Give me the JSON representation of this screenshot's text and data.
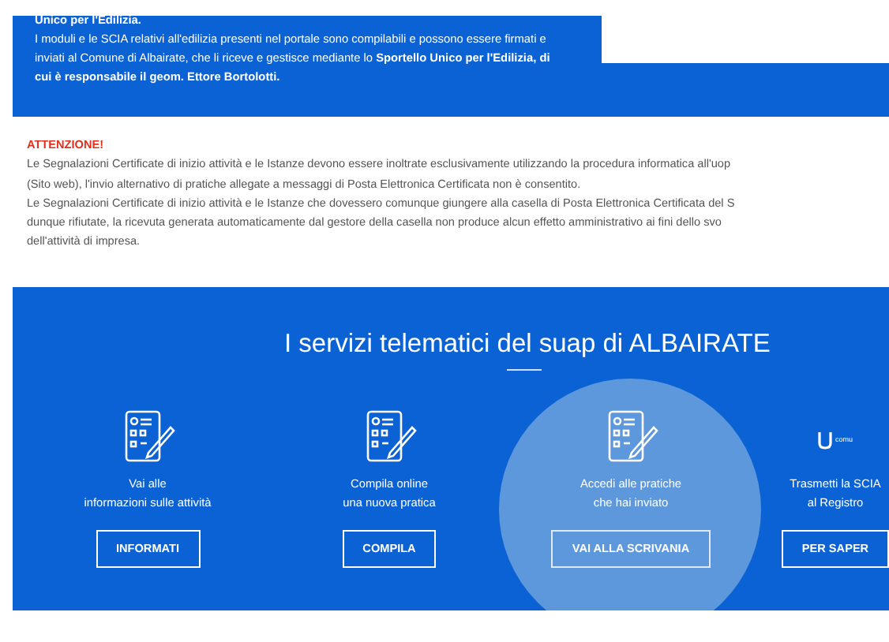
{
  "intro": {
    "heading": "Unico per l'Edilizia.",
    "text": "I moduli e le SCIA relativi all'edilizia presenti nel portale sono compilabili e possono essere firmati e inviati al Comune di Albairate, che li riceve e gestisce mediante lo **Sportello Unico per l'Edilizia, di cui è responsabile il geom. Ettore Bortolotti.**"
  },
  "notice": {
    "heading": "ATTENZIONE!",
    "lines": [
      "Le Segnalazioni Certificate di inizio attività e le Istanze devono essere inoltrate esclusivamente utilizzando la procedura informatica all'uop",
      "(Sito web), l'invio alternativo di pratiche allegate a messaggi di Posta Elettronica Certificata non è consentito.",
      "Le Segnalazioni Certificate di inizio attività e le Istanze che dovessero comunque giungere alla casella di Posta Elettronica Certificata del S",
      "dunque rifiutate, la ricevuta generata automaticamente dal gestore della casella non produce alcun effetto amministrativo ai fini dello svo",
      "dell'attività di impresa."
    ]
  },
  "services": {
    "title": "I servizi telematici del suap di ALBAIRATE",
    "items": [
      {
        "kind": "form",
        "lines": [
          "Vai alle",
          "informazioni sulle attività"
        ],
        "button": "INFORMATI",
        "selected": false
      },
      {
        "kind": "form",
        "lines": [
          "Compila online",
          "una nuova pratica"
        ],
        "button": "COMPILA",
        "selected": false
      },
      {
        "kind": "form",
        "lines": [
          "Accedi alle pratiche",
          "che hai inviato"
        ],
        "button": "VAI ALLA SCRIVANIA",
        "selected": true
      },
      {
        "kind": "logo",
        "logo_text": "comu",
        "lines": [
          "Trasmetti la SCIA",
          "al Registro"
        ],
        "button": "PER SAPER",
        "selected": false
      }
    ]
  }
}
